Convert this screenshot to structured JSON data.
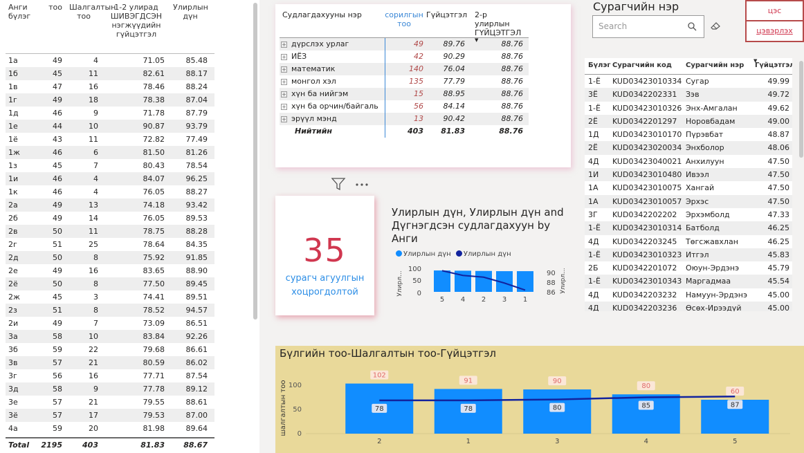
{
  "left_table": {
    "headers": [
      "Анги бүлэг",
      "тоо",
      "Шалгалтын тоо",
      "1-2 улирад ШИВЭГДСЭН нэгжүүдийн гүйцэтгэл",
      "Улирлын дүн"
    ],
    "rows": [
      [
        "1а",
        "49",
        "4",
        "71.05",
        "85.48"
      ],
      [
        "1б",
        "45",
        "11",
        "82.61",
        "88.17"
      ],
      [
        "1в",
        "47",
        "16",
        "78.46",
        "88.24"
      ],
      [
        "1г",
        "49",
        "18",
        "78.38",
        "87.04"
      ],
      [
        "1д",
        "46",
        "9",
        "71.78",
        "87.79"
      ],
      [
        "1е",
        "44",
        "10",
        "90.87",
        "93.79"
      ],
      [
        "1ё",
        "43",
        "11",
        "72.82",
        "77.49"
      ],
      [
        "1ж",
        "46",
        "6",
        "81.50",
        "81.26"
      ],
      [
        "1з",
        "45",
        "7",
        "80.43",
        "78.54"
      ],
      [
        "1и",
        "46",
        "4",
        "84.07",
        "96.25"
      ],
      [
        "1к",
        "46",
        "4",
        "76.05",
        "88.27"
      ],
      [
        "2а",
        "49",
        "13",
        "74.18",
        "93.42"
      ],
      [
        "2б",
        "49",
        "14",
        "76.05",
        "89.53"
      ],
      [
        "2в",
        "50",
        "11",
        "78.75",
        "88.28"
      ],
      [
        "2г",
        "51",
        "25",
        "78.64",
        "84.35"
      ],
      [
        "2д",
        "50",
        "8",
        "75.92",
        "91.85"
      ],
      [
        "2е",
        "49",
        "16",
        "83.65",
        "88.90"
      ],
      [
        "2ё",
        "50",
        "8",
        "77.50",
        "89.45"
      ],
      [
        "2ж",
        "45",
        "3",
        "74.41",
        "89.51"
      ],
      [
        "2з",
        "51",
        "8",
        "78.52",
        "94.57"
      ],
      [
        "2и",
        "49",
        "7",
        "73.09",
        "86.51"
      ],
      [
        "3а",
        "58",
        "10",
        "83.84",
        "92.26"
      ],
      [
        "3б",
        "59",
        "22",
        "79.68",
        "86.61"
      ],
      [
        "3в",
        "57",
        "21",
        "80.59",
        "86.02"
      ],
      [
        "3г",
        "56",
        "16",
        "77.71",
        "87.54"
      ],
      [
        "3д",
        "58",
        "9",
        "77.78",
        "89.12"
      ],
      [
        "3е",
        "57",
        "21",
        "79.55",
        "88.61"
      ],
      [
        "3ё",
        "57",
        "17",
        "79.53",
        "87.00"
      ],
      [
        "4а",
        "59",
        "20",
        "81.98",
        "89.64"
      ]
    ],
    "total": [
      "Total",
      "2195",
      "403",
      "81.83",
      "88.67"
    ]
  },
  "subject_table": {
    "headers": [
      "Судлагдахууны нэр",
      "сорилгын тоо",
      "Гүйцэтгэл",
      "2-р улирлын ГҮЙЦЭТГЭЛ"
    ],
    "rows": [
      [
        "дүрслэх урлаг",
        "49",
        "89.76",
        "88.76"
      ],
      [
        "ИЁЗ",
        "42",
        "90.29",
        "88.76"
      ],
      [
        "математик",
        "140",
        "76.04",
        "88.76"
      ],
      [
        "монгол хэл",
        "135",
        "77.79",
        "88.76"
      ],
      [
        "хүн ба нийгэм",
        "15",
        "88.95",
        "88.76"
      ],
      [
        "хүн ба орчин/байгаль",
        "56",
        "84.14",
        "88.76"
      ],
      [
        "эрүүл мэнд",
        "13",
        "90.42",
        "88.76"
      ]
    ],
    "total": [
      "Нийтийн",
      "403",
      "81.83",
      "88.76"
    ]
  },
  "card": {
    "value": "35",
    "label": "сурагч агуулгын хоцрогдолтой"
  },
  "mini_chart": {
    "title": "Улирлын дүн, Улирлын дүн and Дүгнэгдсэн судлагдахуун by Анги",
    "legend": [
      "Улирлын дүн",
      "Улирлын дүн"
    ],
    "y_left_label": "Улирл...",
    "y_right_label": "Улирл...",
    "y_left_ticks": [
      "100",
      "50",
      "0"
    ],
    "y_right_ticks": [
      "90",
      "88",
      "86"
    ]
  },
  "bottom_chart": {
    "title": "Бүлгийн тоо-Шалгалтын тоо-Гүйцэтгэл",
    "ylabel": "шалгалтын тоо",
    "y_ticks": [
      "100",
      "50",
      "0"
    ]
  },
  "chart_data": [
    {
      "type": "bar",
      "categories": [
        "5",
        "4",
        "2",
        "3",
        "1"
      ],
      "series": [
        {
          "name": "Улирлын дүн",
          "type": "bar",
          "values": [
            91,
            90,
            89,
            88,
            88
          ]
        },
        {
          "name": "Улирлын дүн",
          "type": "line",
          "values": [
            89.6,
            88.8,
            88.5,
            87.5,
            86.3
          ]
        }
      ],
      "title": "Улирлын дүн, Улирлын дүн and Дүгнэгдсэн судлагдахуун by Анги",
      "ylim": [
        0,
        100
      ],
      "y2lim": [
        86,
        90
      ]
    },
    {
      "type": "bar",
      "categories": [
        "2",
        "1",
        "3",
        "4",
        "5"
      ],
      "series": [
        {
          "type": "bar",
          "values": [
            102,
            91,
            90,
            80,
            69
          ]
        },
        {
          "type": "line",
          "values": [
            78,
            78,
            80,
            85,
            87
          ]
        }
      ],
      "bar_labels": [
        "102",
        "91",
        "90",
        "80",
        "60"
      ],
      "line_labels": [
        "78",
        "78",
        "80",
        "85",
        "87"
      ],
      "title": "Бүлгийн тоо-Шалгалтын тоо-Гүйцэтгэл",
      "ylabel": "шалгалтын тоо",
      "ylim": [
        0,
        120
      ],
      "y2lim": [
        0,
        100
      ]
    }
  ],
  "student_panel": {
    "title": "Сурагчийн нэр",
    "search_placeholder": "Search",
    "btn_a": "цэс",
    "btn_b": "цэвэрлэх",
    "headers": [
      "Бүлэг",
      "Сурагчийн код",
      "Сурагчийн нэр",
      "Гүйцэтгэл"
    ],
    "rows": [
      [
        "1-Ё",
        "KUD03423010334",
        "Сугар",
        "49.99"
      ],
      [
        "3Ё",
        "KUD0342202331",
        "Зэв",
        "49.72"
      ],
      [
        "1-Ё",
        "KUD03423010326",
        "Энх-Амгалан",
        "49.62"
      ],
      [
        "2Ё",
        "KUD0342201297",
        "Норовбадам",
        "49.00"
      ],
      [
        "1Д",
        "KUD03423010170",
        "Пүрэвбат",
        "48.87"
      ],
      [
        "2Ё",
        "KUD03423020034",
        "Энхболор",
        "48.06"
      ],
      [
        "4Д",
        "KUD03423040021",
        "Анхилуун",
        "47.50"
      ],
      [
        "1И",
        "KUD03423010480",
        "Ивээл",
        "47.50"
      ],
      [
        "1А",
        "KUD03423010075",
        "Хангай",
        "47.50"
      ],
      [
        "1А",
        "KUD03423010057",
        "Эрхэс",
        "47.50"
      ],
      [
        "3Г",
        "KUD0342202202",
        "Эрхэмболд",
        "47.33"
      ],
      [
        "1-Ё",
        "KUD03423010314",
        "Батболд",
        "46.25"
      ],
      [
        "4Д",
        "KUD0342203245",
        "Төгсжавхлан",
        "46.25"
      ],
      [
        "1-Ё",
        "KUD03423010323",
        "Итгэл",
        "45.83"
      ],
      [
        "2Б",
        "KUD0342201072",
        "Оюун-Эрдэнэ",
        "45.79"
      ],
      [
        "1-Ё",
        "KUD03423010343",
        "Маргадмаа",
        "45.54"
      ],
      [
        "4Д",
        "KUD0342203232",
        "Намуун-Эрдэнэ",
        "45.00"
      ],
      [
        "4Д",
        "KUD0342203236",
        "Өсөх-Ирээдүй",
        "45.00"
      ]
    ]
  },
  "colors": {
    "bar": "#118dff",
    "line": "#12239e",
    "accent_red": "#d0374f",
    "panel_yellow": "#e9d99a"
  }
}
